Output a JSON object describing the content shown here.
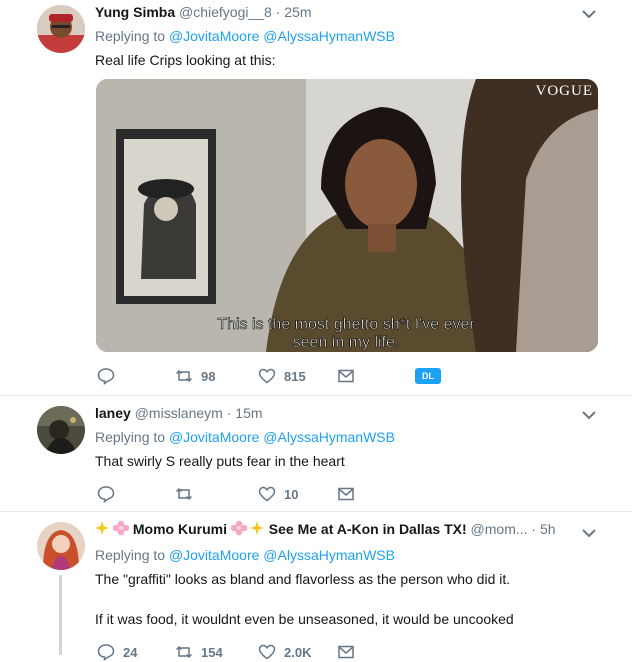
{
  "tweets": [
    {
      "name": "Yung Simba",
      "handle": "@chiefyogi__8",
      "dot": "·",
      "time": "25m",
      "replying_prefix": "Replying to",
      "mentions": [
        "@JovitaMoore",
        "@AlyssaHymanWSB"
      ],
      "text": [
        "Real life Crips looking at this:"
      ],
      "media": {
        "watermark": "VOGUE",
        "caption_line1": "This is the most ghetto sh*t I've ever",
        "caption_line2": "seen in my life."
      },
      "actions": {
        "replies": "",
        "retweets": "98",
        "likes": "815",
        "badge": "DL"
      }
    },
    {
      "name": "laney",
      "handle": "@misslaneym",
      "dot": "·",
      "time": "15m",
      "replying_prefix": "Replying to",
      "mentions": [
        "@JovitaMoore",
        "@AlyssaHymanWSB"
      ],
      "text": [
        "That swirly S really puts fear in the heart"
      ],
      "actions": {
        "replies": "",
        "retweets": "",
        "likes": "10"
      }
    },
    {
      "name": "Momo Kurumi",
      "name_suffix": "See Me at A-Kon in Dallas TX!",
      "handle": "@mom...",
      "dot": "·",
      "time": "5h",
      "replying_prefix": "Replying to",
      "mentions": [
        "@JovitaMoore",
        "@AlyssaHymanWSB"
      ],
      "text": [
        "The \"graffiti\" looks as bland and flavorless as the person who did it.",
        "If it was food, it wouldnt even be unseasoned, it would be uncooked"
      ],
      "actions": {
        "replies": "24",
        "retweets": "154",
        "likes": "2.0K"
      }
    }
  ],
  "colors": {
    "accent": "#1da1f2",
    "muted": "#657786",
    "text": "#14171a",
    "divider": "#e6ecf0"
  }
}
